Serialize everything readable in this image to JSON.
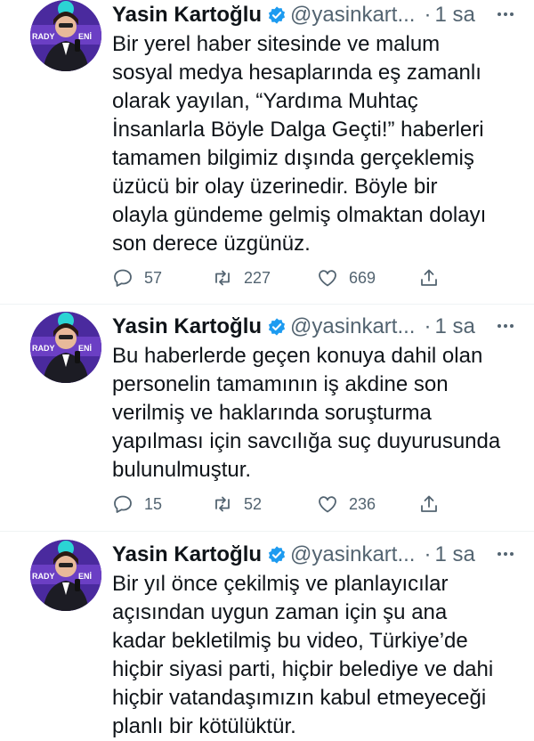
{
  "tweets": [
    {
      "author_name": "Yasin Kartoğlu",
      "handle": "@yasinkart...",
      "separator": "·",
      "time": "1 sa",
      "lines": [
        "Bir yerel haber sitesinde ve malum",
        "sosyal medya hesaplarında eş zamanlı",
        "olarak yayılan, “Yardıma Muhtaç",
        "İnsanlarla Böyle Dalga Geçti!” haberleri",
        "tamamen bilgimiz dışında gerçeklemiş",
        "üzücü bir olay üzerinedir. Böyle bir",
        "olayla gündeme gelmiş olmaktan dolayı",
        "son derece üzgünüz."
      ],
      "replies": "57",
      "retweets": "227",
      "likes": "669"
    },
    {
      "author_name": "Yasin Kartoğlu",
      "handle": "@yasinkart...",
      "separator": "·",
      "time": "1 sa",
      "lines": [
        "Bu haberlerde geçen konuya dahil olan",
        "personelin tamamının iş akdine son",
        "verilmiş ve haklarında soruşturma",
        "yapılması için savcılığa suç duyurusunda",
        "bulunulmuştur."
      ],
      "replies": "15",
      "retweets": "52",
      "likes": "236"
    },
    {
      "author_name": "Yasin Kartoğlu",
      "handle": "@yasinkart...",
      "separator": "·",
      "time": "1 sa",
      "lines": [
        "Bir yıl önce çekilmiş ve planlayıcılar",
        "açısından uygun zaman için şu ana",
        "kadar bekletilmiş bu video, Türkiye’de",
        "hiçbir siyasi parti, hiçbir belediye ve dahi",
        "hiçbir vatandaşımızın kabul etmeyeceği",
        "planlı bir kötülüktür."
      ]
    }
  ],
  "colors": {
    "text": "#0f1419",
    "secondary": "#536471",
    "verified": "#1d9bf0",
    "avatar_bg": "#4a2a9e",
    "divider": "#eff3f4"
  },
  "icons": [
    "verified-badge-icon",
    "more-icon",
    "reply-icon",
    "retweet-icon",
    "like-icon",
    "share-icon"
  ]
}
